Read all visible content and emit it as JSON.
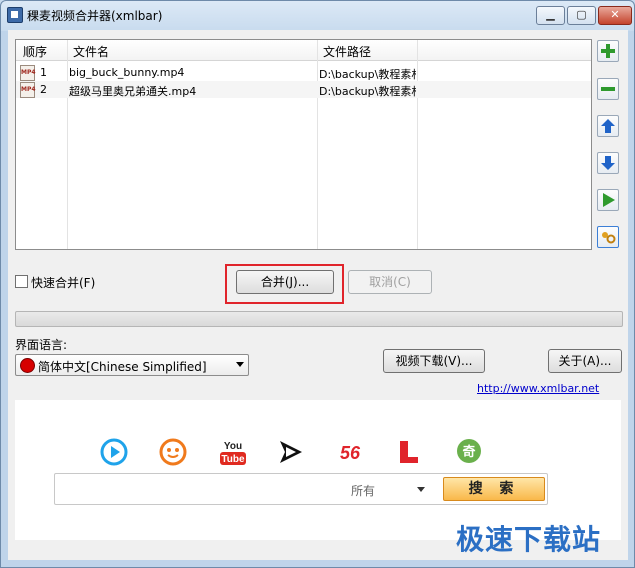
{
  "window": {
    "title": "稞麦视频合并器(xmlbar)"
  },
  "list": {
    "columns": [
      "顺序",
      "文件名",
      "文件路径"
    ],
    "rows": [
      {
        "order": "1",
        "filename": "big_buck_bunny.mp4",
        "path": "D:\\backup\\教程素材",
        "icon": "MP4"
      },
      {
        "order": "2",
        "filename": "超级马里奥兄弟通关.mp4",
        "path": "D:\\backup\\教程素材",
        "icon": "MP4"
      }
    ]
  },
  "side_buttons": {
    "add": "add-icon",
    "remove": "remove-icon",
    "up": "arrow-up-icon",
    "down": "arrow-down-icon",
    "play": "play-icon",
    "settings": "settings-icon"
  },
  "options": {
    "fast_merge_label": "快速合并(F)",
    "fast_merge_checked": false
  },
  "actions": {
    "merge_label": "合并(J)...",
    "cancel_label": "取消(C)"
  },
  "progress": {
    "value": 0
  },
  "language": {
    "label": "界面语言:",
    "selected": "简体中文[Chinese Simplified]"
  },
  "buttons": {
    "video_download": "视频下载(V)...",
    "about": "关于(A)..."
  },
  "link": {
    "text": "http://www.xmlbar.net"
  },
  "search": {
    "placeholder": "",
    "scope": "所有",
    "button": "搜 索"
  },
  "brands": [
    "youku-icon",
    "tudou-icon",
    "youtube-icon",
    "iqiyi-icon",
    "56-icon",
    "letv-icon",
    "qiyi-icon"
  ],
  "brand_texts": {
    "youtube_top": "You",
    "youtube_bottom": "Tube",
    "fivesix": "56",
    "qi": "奇"
  },
  "watermark": {
    "text": "极速下载站"
  },
  "colors": {
    "accent": "#2b6fc4",
    "highlight": "#e0242b",
    "link": "#0000cc"
  }
}
